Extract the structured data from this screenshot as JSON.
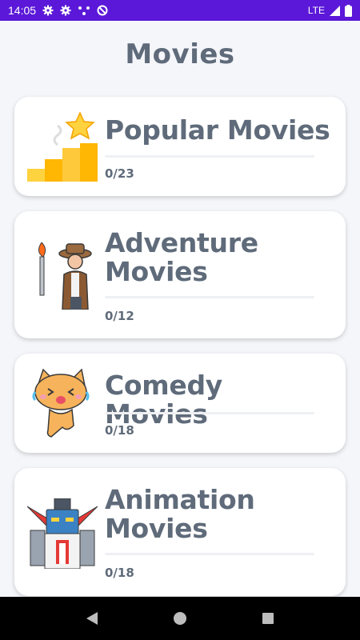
{
  "status_bar": {
    "time": "14:05",
    "network": "LTE"
  },
  "header": {
    "title": "Movies"
  },
  "categories": [
    {
      "title": "Popular Movies",
      "progress": "0/23",
      "icon": "trophy-stairs-star-icon"
    },
    {
      "title": "Adventure Movies",
      "progress": "0/12",
      "icon": "explorer-torch-icon"
    },
    {
      "title": "Comedy Movies",
      "progress": "0/18",
      "icon": "laughing-cat-icon"
    },
    {
      "title": "Animation Movies",
      "progress": "0/18",
      "icon": "robot-mecha-icon"
    }
  ],
  "colors": {
    "status_bar": "#5b18d8",
    "text": "#5f6b7a",
    "background": "#f5f6fa"
  }
}
